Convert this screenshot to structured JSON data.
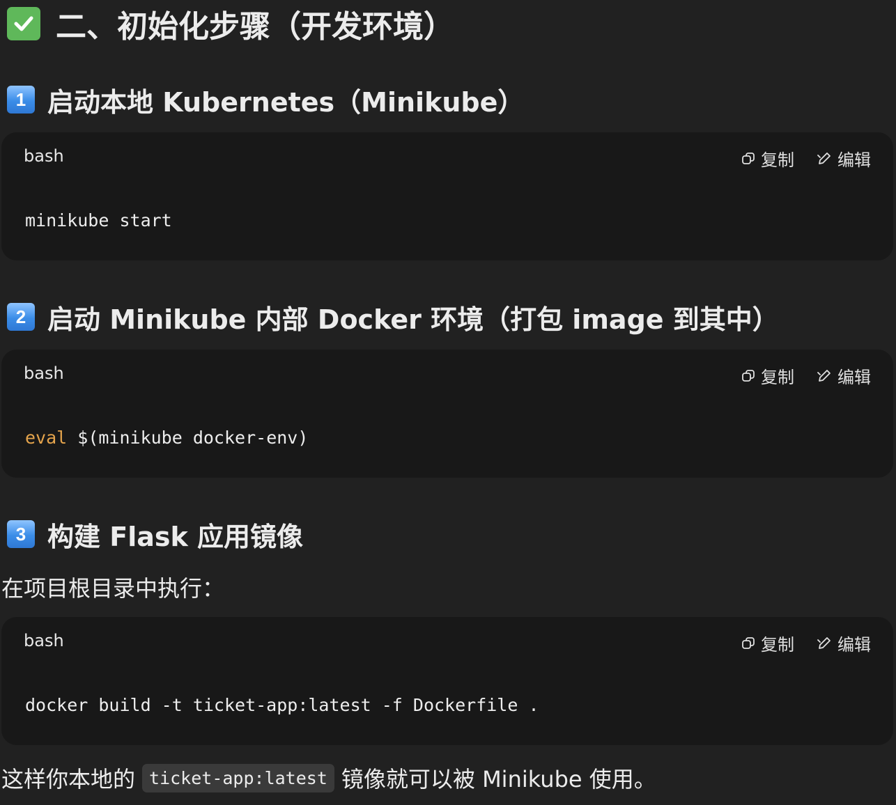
{
  "heading": {
    "text": "二、初始化步骤（开发环境）",
    "icon": "check-mark-button-icon",
    "icon_color": "#5fb85a"
  },
  "sections": [
    {
      "number": "1",
      "title": "启动本地 Kubernetes（Minikube）",
      "code": {
        "language": "bash",
        "copy_label": "复制",
        "edit_label": "编辑",
        "command": "minikube start"
      }
    },
    {
      "number": "2",
      "title": "启动 Minikube 内部 Docker 环境（打包 image 到其中）",
      "code": {
        "language": "bash",
        "copy_label": "复制",
        "edit_label": "编辑",
        "keyword": "eval",
        "command_rest": " $(minikube docker-env)"
      }
    },
    {
      "number": "3",
      "title": "构建 Flask 应用镜像",
      "intro": "在项目根目录中执行：",
      "code": {
        "language": "bash",
        "copy_label": "复制",
        "edit_label": "编辑",
        "command": "docker build -t ticket-app:latest -f Dockerfile ."
      }
    }
  ],
  "footer": {
    "before": "这样你本地的",
    "inline_code": "ticket-app:latest",
    "after": "镜像就可以被 Minikube 使用。"
  },
  "colors": {
    "background": "#212121",
    "code_background": "#181818",
    "keyword": "#e5a44c",
    "number_icon": "#3b8de8"
  }
}
